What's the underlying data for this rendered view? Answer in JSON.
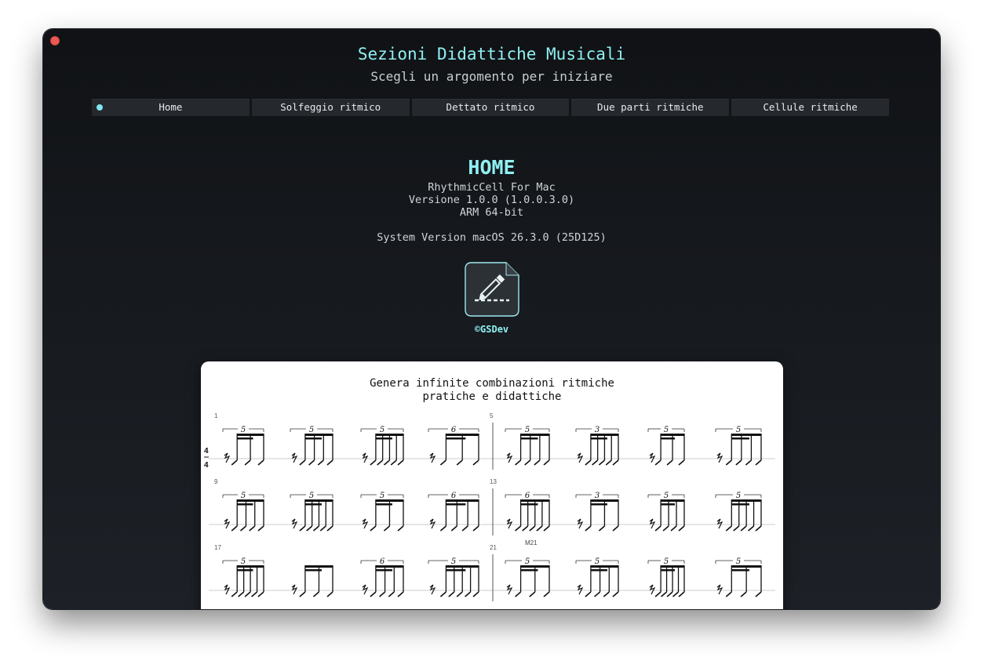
{
  "app": {
    "title": "Sezioni Didattiche Musicali",
    "subtitle": "Scegli un argomento per iniziare"
  },
  "tabs": [
    {
      "label": "Home",
      "active": true
    },
    {
      "label": "Solfeggio ritmico",
      "active": false
    },
    {
      "label": "Dettato ritmico",
      "active": false
    },
    {
      "label": "Due parti ritmiche",
      "active": false
    },
    {
      "label": "Cellule ritmiche",
      "active": false
    }
  ],
  "home": {
    "heading": "HOME",
    "app_name": "RhythmicCell For Mac",
    "version": "Versione 1.0.0 (1.0.0.3.0)",
    "arch": "ARM 64-bit",
    "system_version": "System Version macOS 26.3.0 (25D125)",
    "copyright": "©GSDev"
  },
  "score": {
    "title_line1": "Genera infinite combinazioni ritmiche",
    "title_line2": "pratiche e didattiche",
    "time_signature": {
      "top": "4",
      "bottom": "4"
    },
    "measure_label": "M21",
    "systems": [
      {
        "left_number": "1",
        "right_number": "5",
        "tuplets": [
          "5",
          "5",
          "5",
          "6",
          "5",
          "3",
          "5",
          "5"
        ]
      },
      {
        "left_number": "9",
        "right_number": "13",
        "tuplets": [
          "5",
          "5",
          "5",
          "6",
          "6",
          "3",
          "5",
          "5"
        ]
      },
      {
        "left_number": "17",
        "right_number": "21",
        "tuplets": [
          "5",
          "",
          "6",
          "5",
          "5",
          "5",
          "5",
          "5"
        ]
      }
    ]
  },
  "colors": {
    "accent": "#8ff0f2",
    "tab_bg": "#25282d",
    "close_button": "#ed5a53"
  },
  "icons": {
    "app_icon": "pencil-edit-icon",
    "active_tab_indicator": "dot-icon"
  }
}
